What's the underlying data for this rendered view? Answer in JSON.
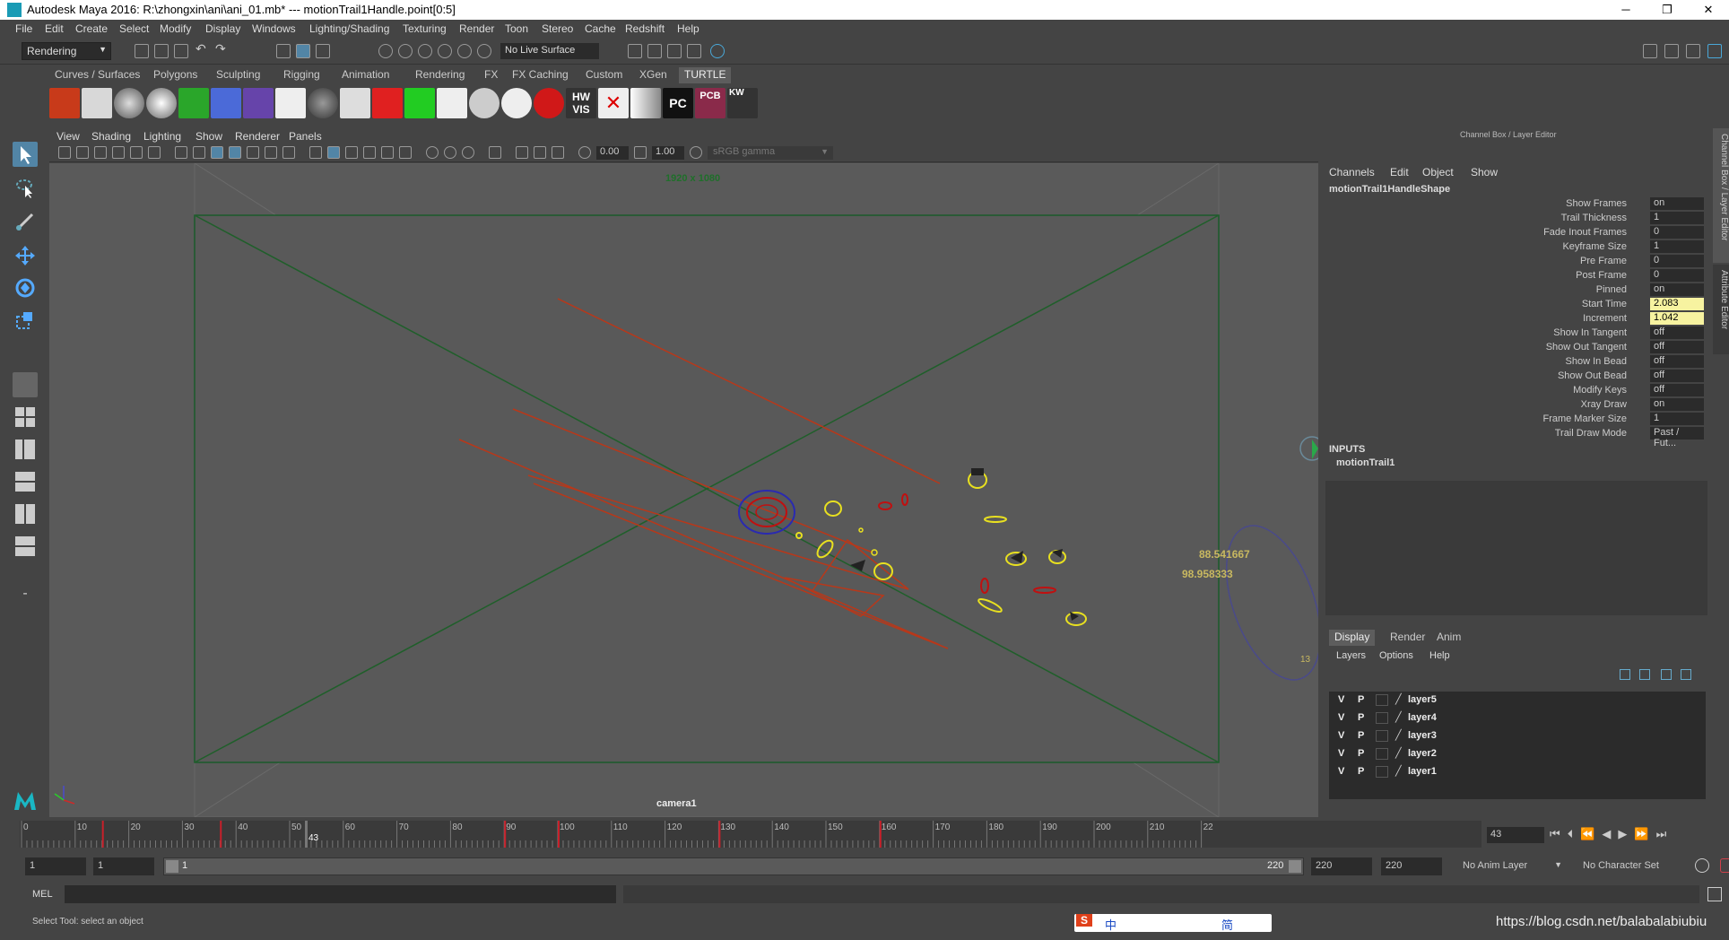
{
  "titlebar": {
    "title": "Autodesk Maya 2016: R:\\zhongxin\\ani\\ani_01.mb*   ---   motionTrail1Handle.point[0:5]",
    "minimize": "─",
    "maximize": "❐",
    "close": "✕"
  },
  "menubar": {
    "items": [
      "File",
      "Edit",
      "Create",
      "Select",
      "Modify",
      "Display",
      "Windows",
      "Lighting/Shading",
      "Texturing",
      "Render",
      "Toon",
      "Stereo",
      "Cache",
      "Redshift",
      "Help"
    ]
  },
  "statusline": {
    "mode": "Rendering",
    "live_surface": "No Live Surface"
  },
  "shelf": {
    "tabs": [
      "Curves / Surfaces",
      "Polygons",
      "Sculpting",
      "Rigging",
      "Animation",
      "Rendering",
      "FX",
      "FX Caching",
      "Custom",
      "XGen",
      "TURTLE"
    ],
    "active_tab": "TURTLE",
    "icon_labels": {
      "hw_vis": "HW VIS",
      "pc": "PC",
      "pcb": "PCB",
      "kw": "KW"
    }
  },
  "viewport": {
    "menu": [
      "View",
      "Shading",
      "Lighting",
      "Show",
      "Renderer",
      "Panels"
    ],
    "exposure": "0.00",
    "gamma": "1.00",
    "color_space": "sRGB gamma",
    "resolution": "1920 x 1080",
    "camera": "camera1",
    "annotations": [
      "88.541667",
      "98.958333",
      "13"
    ]
  },
  "channelbox": {
    "title": "Channel Box / Layer Editor",
    "menu": [
      "Channels",
      "Edit",
      "Object",
      "Show"
    ],
    "node": "motionTrail1HandleShape",
    "channels": [
      {
        "label": "Show Frames",
        "value": "on",
        "hl": false
      },
      {
        "label": "Trail Thickness",
        "value": "1",
        "hl": false
      },
      {
        "label": "Fade Inout Frames",
        "value": "0",
        "hl": false
      },
      {
        "label": "Keyframe Size",
        "value": "1",
        "hl": false
      },
      {
        "label": "Pre Frame",
        "value": "0",
        "hl": false
      },
      {
        "label": "Post Frame",
        "value": "0",
        "hl": false
      },
      {
        "label": "Pinned",
        "value": "on",
        "hl": false
      },
      {
        "label": "Start Time",
        "value": "2.083",
        "hl": true
      },
      {
        "label": "Increment",
        "value": "1.042",
        "hl": true
      },
      {
        "label": "Show In Tangent",
        "value": "off",
        "hl": false
      },
      {
        "label": "Show Out Tangent",
        "value": "off",
        "hl": false
      },
      {
        "label": "Show In Bead",
        "value": "off",
        "hl": false
      },
      {
        "label": "Show Out Bead",
        "value": "off",
        "hl": false
      },
      {
        "label": "Modify Keys",
        "value": "off",
        "hl": false
      },
      {
        "label": "Xray Draw",
        "value": "on",
        "hl": false
      },
      {
        "label": "Frame Marker Size",
        "value": "1",
        "hl": false
      },
      {
        "label": "Trail Draw Mode",
        "value": "Past / Fut...",
        "hl": false
      }
    ],
    "inputs_label": "INPUTS",
    "input_node": "motionTrail1",
    "side_tabs": [
      "Channel Box / Layer Editor",
      "Attribute Editor"
    ],
    "layer_tabs": [
      "Display",
      "Render",
      "Anim"
    ],
    "layer_menu": [
      "Layers",
      "Options",
      "Help"
    ],
    "layers": [
      {
        "v": "V",
        "p": "P",
        "name": "layer5"
      },
      {
        "v": "V",
        "p": "P",
        "name": "layer4"
      },
      {
        "v": "V",
        "p": "P",
        "name": "layer3"
      },
      {
        "v": "V",
        "p": "P",
        "name": "layer2"
      },
      {
        "v": "V",
        "p": "P",
        "name": "layer1"
      }
    ]
  },
  "timeline": {
    "ticks": [
      "0",
      "10",
      "20",
      "30",
      "40",
      "50",
      "60",
      "70",
      "80",
      "90",
      "100",
      "110",
      "120",
      "130",
      "140",
      "150",
      "160",
      "170",
      "180",
      "190",
      "200",
      "210",
      "22"
    ],
    "current_frame_marker": "43",
    "current_frame": "43",
    "range_start": "1",
    "range_start2": "1",
    "range_slider_start": "1",
    "range_slider_end": "220",
    "range_end": "220",
    "range_end2": "220",
    "anim_layer": "No Anim Layer",
    "character_set": "No Character Set"
  },
  "cmdline": {
    "label": "MEL"
  },
  "helpline": {
    "text": "Select Tool: select an object",
    "watermark": "https://blog.csdn.net/balabalabiubiu"
  },
  "ime": {
    "s": "S",
    "zh": "中",
    "hans": "简"
  }
}
